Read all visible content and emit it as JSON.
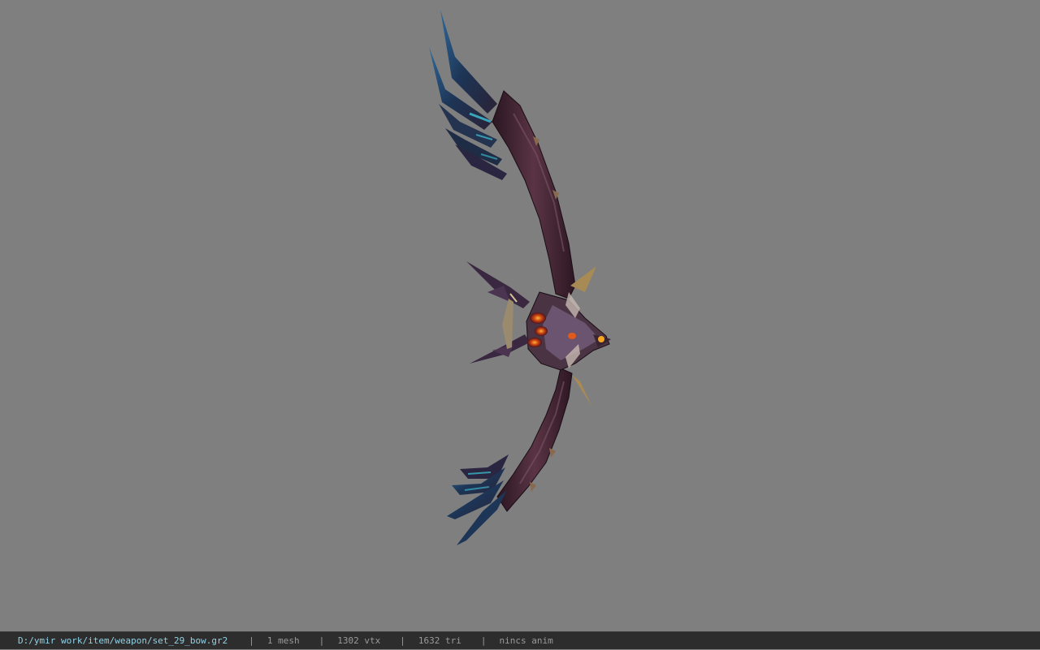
{
  "viewer": {
    "background_color": "#7f7f7f",
    "model_icon": "bow-model-icon"
  },
  "status_bar": {
    "file_path": "D:/ymir work/item/weapon/set_29_bow.gr2",
    "separator": "|",
    "mesh_count": "1 mesh",
    "vertex_count": "1302 vtx",
    "triangle_count": "1632 tri",
    "anim": "nincs anim",
    "path_color": "#8fd3e8",
    "text_color": "#9a9a9a"
  }
}
